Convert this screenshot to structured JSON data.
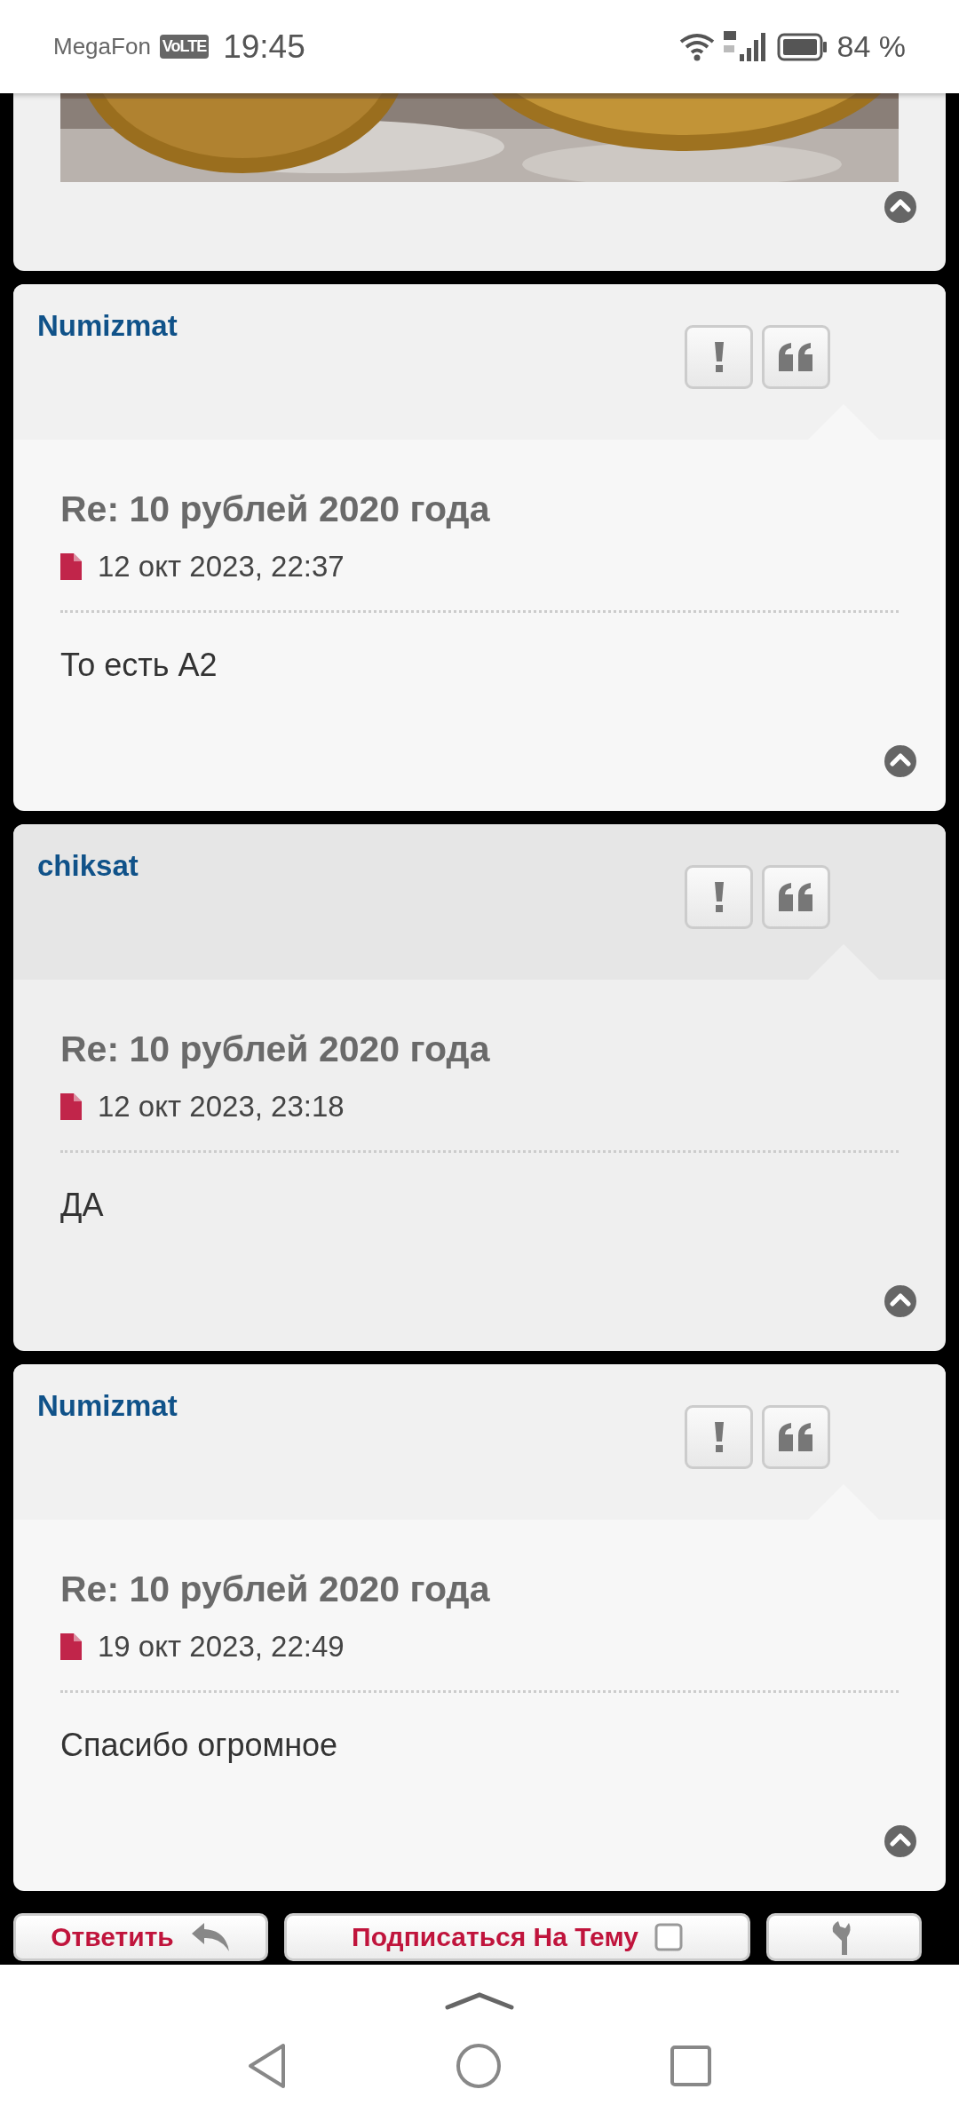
{
  "status_bar": {
    "carrier": "MegaFon",
    "network_badge": "VoLTE",
    "time": "19:45",
    "battery": "84 %"
  },
  "posts": [
    {
      "author": "Numizmat",
      "title": "Re: 10 рублей 2020 года",
      "date": "12 окт 2023, 22:37",
      "text": "То есть А2"
    },
    {
      "author": "chiksat",
      "title": "Re: 10 рублей 2020 года",
      "date": "12 окт 2023, 23:18",
      "text": "ДА"
    },
    {
      "author": "Numizmat",
      "title": "Re: 10 рублей 2020 года",
      "date": "19 окт 2023, 22:49",
      "text": "Спасибо огромное"
    }
  ],
  "actions": [
    {
      "kind": "reply",
      "label": "Ответить"
    },
    {
      "kind": "subscribe",
      "label": "Подписаться На Тему"
    },
    {
      "kind": "tools"
    }
  ]
}
